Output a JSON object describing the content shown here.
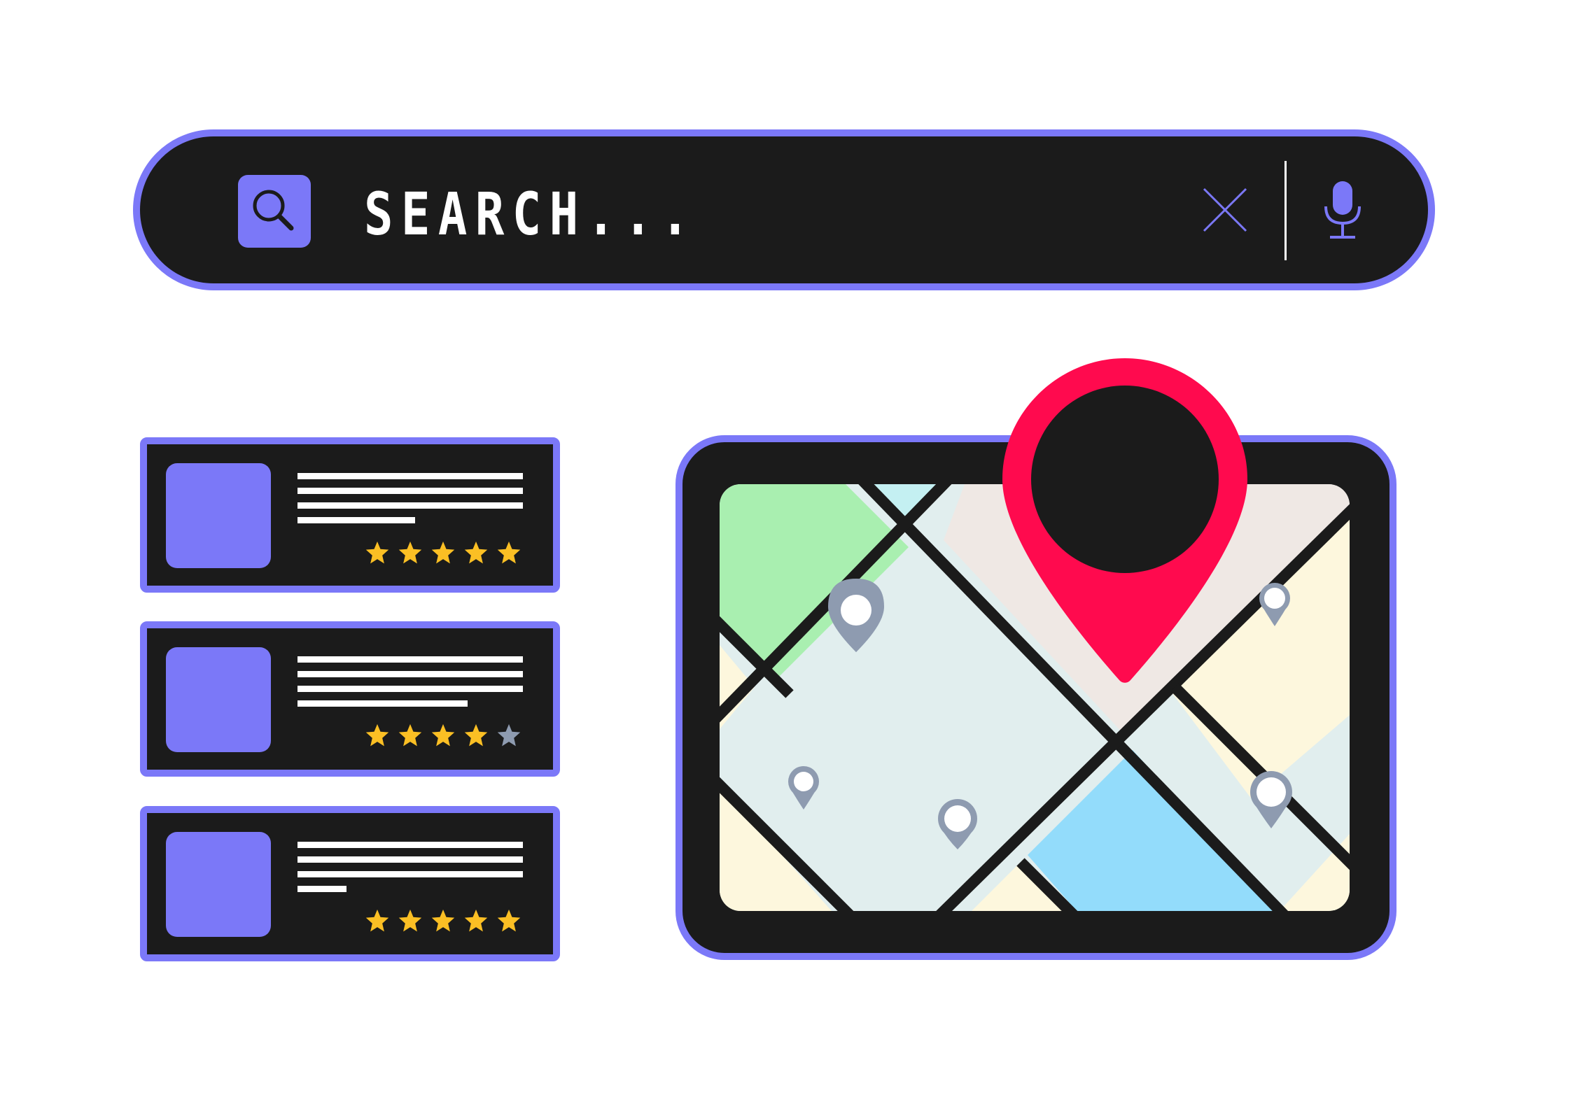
{
  "search": {
    "placeholder": "SEARCH...",
    "icons": {
      "search": "search-icon",
      "clear": "close-icon",
      "voice": "microphone-icon"
    }
  },
  "results": [
    {
      "rating": 5
    },
    {
      "rating": 4
    },
    {
      "rating": 5
    }
  ],
  "map": {
    "selected_pin_color": "#ff0a4e",
    "pin_color": "#8e9bb0"
  },
  "colors": {
    "accent": "#7b78f8",
    "panel": "#1b1b1b",
    "star_on": "#fbbf24",
    "star_off": "#8e9bb0"
  }
}
